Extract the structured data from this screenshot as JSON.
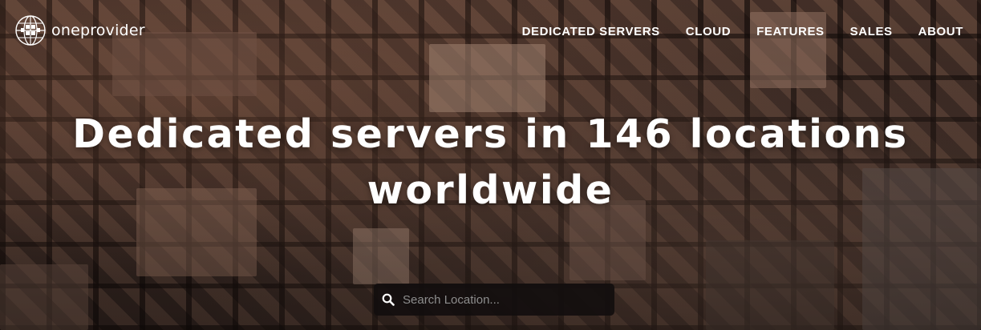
{
  "brand": {
    "name": "oneprovider",
    "logo_icon": "globe-icon"
  },
  "nav": {
    "items": [
      {
        "label": "DEDICATED SERVERS"
      },
      {
        "label": "CLOUD"
      },
      {
        "label": "FEATURES"
      },
      {
        "label": "SALES"
      },
      {
        "label": "ABOUT"
      }
    ]
  },
  "hero": {
    "headline_line1": "Dedicated servers in 146 locations",
    "headline_line2": "worldwide"
  },
  "search": {
    "icon": "search-icon",
    "placeholder": "Search Location..."
  },
  "colors": {
    "text": "#ffffff",
    "search_bg": "#121010",
    "placeholder": "#8d8d8d"
  }
}
